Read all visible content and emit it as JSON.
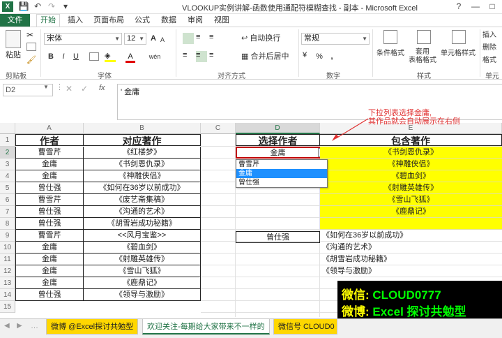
{
  "window": {
    "title": "VLOOKUP实例讲解-函数使用通配符模糊查找 - 副本 - Microsoft Excel",
    "controls": [
      "?",
      "—",
      "□"
    ]
  },
  "quick_access": {
    "app_icon": "excel-icon",
    "save": "save-icon",
    "undo": "undo-icon",
    "redo": "redo-icon"
  },
  "ribbon_tabs": [
    "文件",
    "开始",
    "插入",
    "页面布局",
    "公式",
    "数据",
    "审阅",
    "视图"
  ],
  "ribbon": {
    "clipboard": {
      "paste": "粘贴",
      "label": "剪贴板"
    },
    "font": {
      "name": "宋体",
      "size": "12",
      "bold": "B",
      "italic": "I",
      "underline": "U",
      "grow": "A",
      "shrink": "A",
      "color_letter": "A",
      "wen": "wén",
      "label": "字体"
    },
    "alignment": {
      "wrap": "自动换行",
      "merge": "合并后居中",
      "label": "对齐方式"
    },
    "number": {
      "format": "常规",
      "pct": "%",
      "comma": ",",
      "label": "数字"
    },
    "styles": {
      "cond": "条件格式",
      "table": "套用\n表格格式",
      "cell": "单元格样式",
      "label": "样式"
    },
    "cells": {
      "insert": "插入",
      "delete": "删除",
      "format": "格式",
      "label": "单元格"
    }
  },
  "formula_bar": {
    "name_box": "D2",
    "fx": "fx",
    "content": "' 金庸"
  },
  "columns": [
    "A",
    "B",
    "C",
    "D",
    "E"
  ],
  "rows": [
    "1",
    "2",
    "3",
    "4",
    "5",
    "6",
    "7",
    "8",
    "9",
    "10",
    "11",
    "12",
    "13",
    "14",
    "15"
  ],
  "headers": {
    "a": "作者",
    "b": "对应著作",
    "d": "选择作者",
    "e": "包含著作"
  },
  "table_a": [
    "曹雪芹",
    "金庸",
    "金庸",
    "曾仕强",
    "曹雪芹",
    "曾仕强",
    "曾仕强",
    "曹雪芹",
    "金庸",
    "金庸",
    "金庸",
    "金庸",
    "曾仕强"
  ],
  "table_b": [
    "《红楼梦》",
    "《书剑恩仇录》",
    "《神雕侠侣》",
    "《如何在36岁以前成功》",
    "《废艺斋集稿》",
    "《沟通的艺术》",
    "《胡雪岩成功秘籍》",
    "<<风月宝鉴>>",
    "《碧血剑》",
    "《射雕英雄传》",
    "《雪山飞狐》",
    "《鹿鼎记》",
    "《领导与激励》"
  ],
  "d2_value": "金庸",
  "dropdown_options": [
    "曹雪芹",
    "金庸",
    "曾仕强"
  ],
  "dropdown_selected": "金庸",
  "results_yellow": [
    "《书剑恩仇录》",
    "《神雕侠侣》",
    "《碧血剑》",
    "《射雕英雄传》",
    "《雪山飞狐》",
    "《鹿鼎记》"
  ],
  "d9_value": "曾仕强",
  "results_plain": [
    "《如何在36岁以前成功》",
    "《沟通的艺术》",
    "《胡雪岩成功秘籍》",
    "《领导与激励》"
  ],
  "annotation": {
    "line1": "下拉列表选择金庸,",
    "line2": "其作品就会自动展示在右侧"
  },
  "watermark": {
    "line1": "微信: CLOUD0777",
    "line2": "微博: Excel 探讨共勉型"
  },
  "sheet_tabs": [
    "微博 @Excel探讨共勉型",
    "欢迎关注-每期给大家带来不一样的",
    "微信号 CLOUD0"
  ],
  "colors": {
    "excel_green": "#217346",
    "highlight": "#ffff00",
    "annotation": "#e03030",
    "selection_blue": "#1e90ff",
    "watermark_text": "#ffff00",
    "watermark_text2": "#00ff00"
  }
}
